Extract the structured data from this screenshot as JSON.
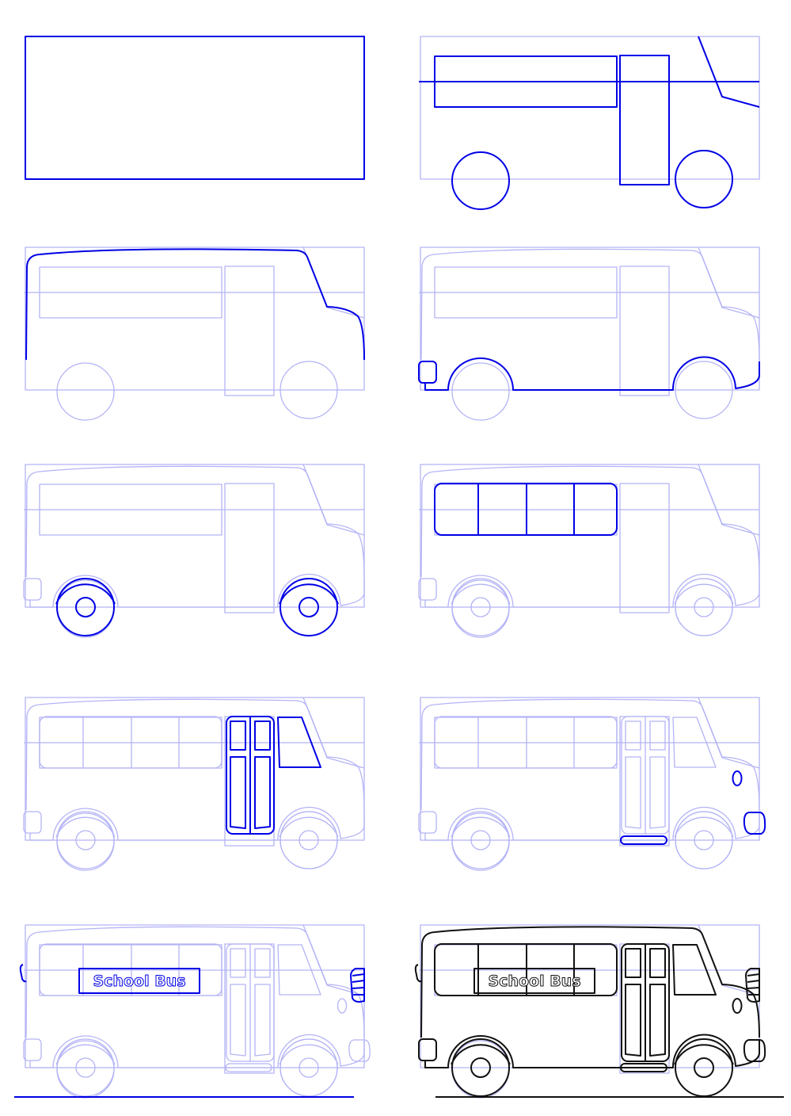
{
  "sign_text": "School Bus",
  "colors": {
    "guide": "#b4b4f6",
    "current_step": "#0000e6",
    "final": "#111111",
    "background": "#ffffff"
  },
  "steps": [
    {
      "step": 1,
      "new_parts": [
        "base-rectangle"
      ]
    },
    {
      "step": 2,
      "new_parts": [
        "window-guide",
        "door-guide",
        "horizontal-guide",
        "front-slope-guide",
        "wheel-guides"
      ]
    },
    {
      "step": 3,
      "new_parts": [
        "body-top-outline"
      ]
    },
    {
      "step": 4,
      "new_parts": [
        "body-bottom-outline",
        "rear-bumper"
      ]
    },
    {
      "step": 5,
      "new_parts": [
        "wheels"
      ]
    },
    {
      "step": 6,
      "new_parts": [
        "windows"
      ]
    },
    {
      "step": 7,
      "new_parts": [
        "door",
        "windshield"
      ]
    },
    {
      "step": 8,
      "new_parts": [
        "headlight",
        "front-bumper",
        "door-step"
      ]
    },
    {
      "step": 9,
      "new_parts": [
        "name-sign",
        "grille",
        "mirror",
        "ground-line"
      ]
    },
    {
      "step": 10,
      "new_parts": [
        "final-inked-bus"
      ]
    }
  ]
}
